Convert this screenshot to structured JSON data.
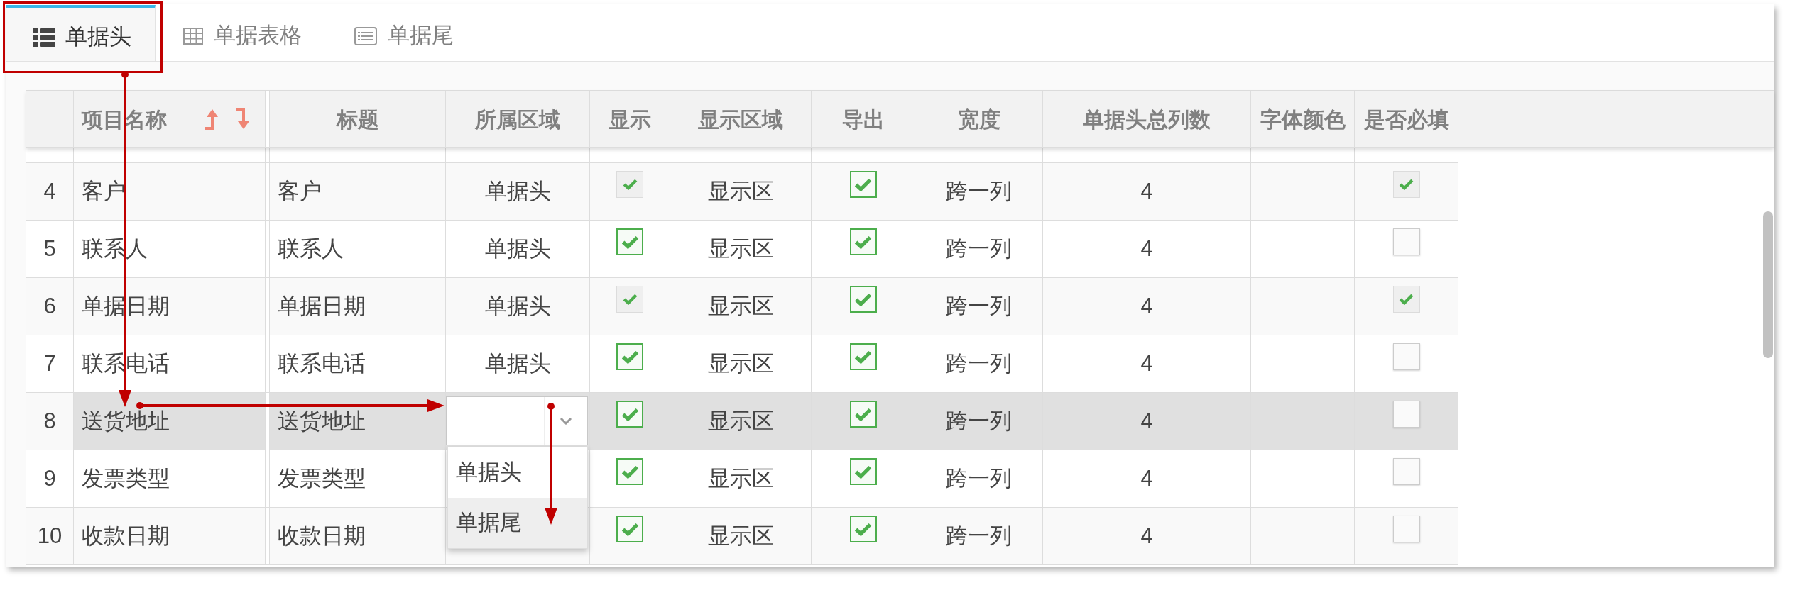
{
  "tabs": [
    {
      "kind": "list",
      "label": "单据头",
      "selected": true
    },
    {
      "kind": "grid",
      "label": "单据表格",
      "selected": false
    },
    {
      "kind": "form",
      "label": "单据尾",
      "selected": false
    }
  ],
  "table": {
    "columns": [
      {
        "label": "项目名称",
        "sortable": true
      },
      {
        "label": "标题",
        "sortable": false
      },
      {
        "label": "所属区域",
        "sortable": false
      },
      {
        "label": "显示",
        "sortable": false
      },
      {
        "label": "显示区域",
        "sortable": false
      },
      {
        "label": "导出",
        "sortable": false
      },
      {
        "label": "宽度",
        "sortable": false
      },
      {
        "label": "单据头总列数",
        "sortable": false
      },
      {
        "label": "字体颜色",
        "sortable": false
      },
      {
        "label": "是否必填",
        "sortable": false
      }
    ],
    "rows": [
      {
        "number": "4",
        "name": "客户",
        "title": "客户",
        "area": {
          "kind": "text",
          "value": "单据头"
        },
        "show": {
          "checked": true,
          "disabled": true
        },
        "show_area": "显示区",
        "export": {
          "checked": true,
          "disabled": false
        },
        "width": "跨一列",
        "total_columns": "4",
        "required": {
          "checked": true,
          "disabled": true
        },
        "selected": false
      },
      {
        "number": "5",
        "name": "联系人",
        "title": "联系人",
        "area": {
          "kind": "text",
          "value": "单据头"
        },
        "show": {
          "checked": true,
          "disabled": false
        },
        "show_area": "显示区",
        "export": {
          "checked": true,
          "disabled": false
        },
        "width": "跨一列",
        "total_columns": "4",
        "required": {
          "checked": false,
          "disabled": false
        },
        "selected": false
      },
      {
        "number": "6",
        "name": "单据日期",
        "title": "单据日期",
        "area": {
          "kind": "text",
          "value": "单据头"
        },
        "show": {
          "checked": true,
          "disabled": true
        },
        "show_area": "显示区",
        "export": {
          "checked": true,
          "disabled": false
        },
        "width": "跨一列",
        "total_columns": "4",
        "required": {
          "checked": true,
          "disabled": true
        },
        "selected": false
      },
      {
        "number": "7",
        "name": "联系电话",
        "title": "联系电话",
        "area": {
          "kind": "text",
          "value": "单据头"
        },
        "show": {
          "checked": true,
          "disabled": false
        },
        "show_area": "显示区",
        "export": {
          "checked": true,
          "disabled": false
        },
        "width": "跨一列",
        "total_columns": "4",
        "required": {
          "checked": false,
          "disabled": false
        },
        "selected": false
      },
      {
        "number": "8",
        "name": "送货地址",
        "title": "送货地址",
        "area": {
          "kind": "select",
          "open": true,
          "options": [
            {
              "label": "单据头",
              "selected": false
            },
            {
              "label": "单据尾",
              "selected": true
            }
          ]
        },
        "show": {
          "checked": true,
          "disabled": false
        },
        "show_area": "显示区",
        "export": {
          "checked": true,
          "disabled": false
        },
        "width": "跨一列",
        "total_columns": "4",
        "required": {
          "checked": false,
          "disabled": false
        },
        "selected": true
      },
      {
        "number": "9",
        "name": "发票类型",
        "title": "发票类型",
        "area": {
          "kind": "hidden"
        },
        "show": {
          "checked": true,
          "disabled": false
        },
        "show_area": "显示区",
        "export": {
          "checked": true,
          "disabled": false
        },
        "width": "跨一列",
        "total_columns": "4",
        "required": {
          "checked": false,
          "disabled": false
        },
        "selected": false
      },
      {
        "number": "10",
        "name": "收款日期",
        "title": "收款日期",
        "area": {
          "kind": "hidden"
        },
        "show": {
          "checked": true,
          "disabled": false
        },
        "show_area": "显示区",
        "export": {
          "checked": true,
          "disabled": false
        },
        "width": "跨一列",
        "total_columns": "4",
        "required": {
          "checked": false,
          "disabled": false
        },
        "selected": false
      }
    ]
  }
}
